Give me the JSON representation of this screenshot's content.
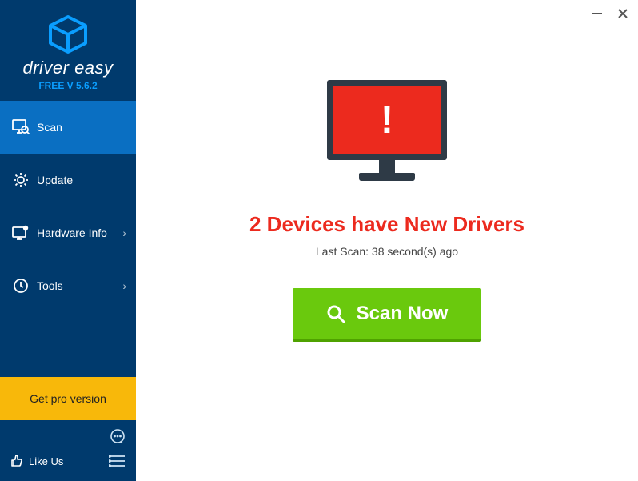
{
  "brand": {
    "name": "driver easy",
    "version": "FREE V 5.6.2"
  },
  "sidebar": {
    "items": [
      {
        "label": "Scan",
        "active": true,
        "hasChevron": false
      },
      {
        "label": "Update",
        "active": false,
        "hasChevron": false
      },
      {
        "label": "Hardware Info",
        "active": false,
        "hasChevron": true
      },
      {
        "label": "Tools",
        "active": false,
        "hasChevron": true
      }
    ],
    "pro_label": "Get pro version",
    "like_label": "Like Us"
  },
  "main": {
    "headline": "2 Devices have New Drivers",
    "last_scan": "Last Scan: 38 second(s) ago",
    "scan_button": "Scan Now"
  },
  "colors": {
    "sidebar_bg": "#003a6d",
    "sidebar_active": "#0a6fc2",
    "accent_yellow": "#f8b80a",
    "alert_red": "#ec2a1e",
    "scan_green": "#6ac90d"
  }
}
